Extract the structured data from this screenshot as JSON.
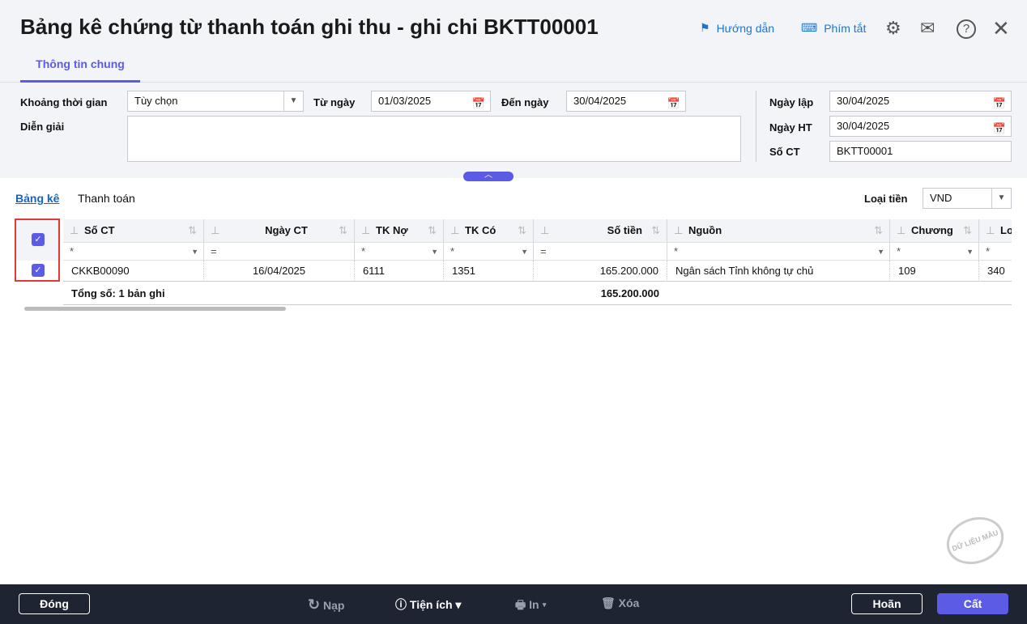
{
  "title": "Bảng kê chứng từ thanh toán ghi thu - ghi chi BKTT00001",
  "toolbar": {
    "guide": "Hướng dẫn",
    "shortcut": "Phím tắt"
  },
  "tab": "Thông tin chung",
  "form": {
    "period_label": "Khoảng thời gian",
    "period_value": "Tùy chọn",
    "from_label": "Từ ngày",
    "from_value": "01/03/2025",
    "to_label": "Đến ngày",
    "to_value": "30/04/2025",
    "desc_label": "Diễn giải",
    "desc_value": "",
    "created_label": "Ngày lập",
    "created_value": "30/04/2025",
    "post_label": "Ngày HT",
    "post_value": "30/04/2025",
    "no_label": "Số CT",
    "no_value": "BKTT00001"
  },
  "subtabs": {
    "list": "Bảng kê",
    "payment": "Thanh toán"
  },
  "currency": {
    "label": "Loại tiền",
    "value": "VND"
  },
  "table": {
    "headers": [
      "Số CT",
      "Ngày CT",
      "TK Nợ",
      "TK Có",
      "Số tiền",
      "Nguồn",
      "Chương",
      "Lo"
    ],
    "filters": [
      "*",
      "=",
      "*",
      "*",
      "=",
      "*",
      "*",
      "*"
    ],
    "rows": [
      [
        "CKKB00090",
        "16/04/2025",
        "6111",
        "1351",
        "165.200.000",
        "Ngân sách Tỉnh không tự chủ",
        "109",
        "340"
      ]
    ],
    "total_label": "Tổng số: ",
    "total_count": "1",
    "total_suffix": " bản ghi",
    "total_amount": "165.200.000"
  },
  "watermark": "DỮ LIỆU MẪU",
  "footer": {
    "close": "Đóng",
    "reload": "Nạp",
    "utilities": "Tiện ích",
    "print": "In",
    "delete": "Xóa",
    "cancel": "Hoãn",
    "save": "Cất"
  }
}
